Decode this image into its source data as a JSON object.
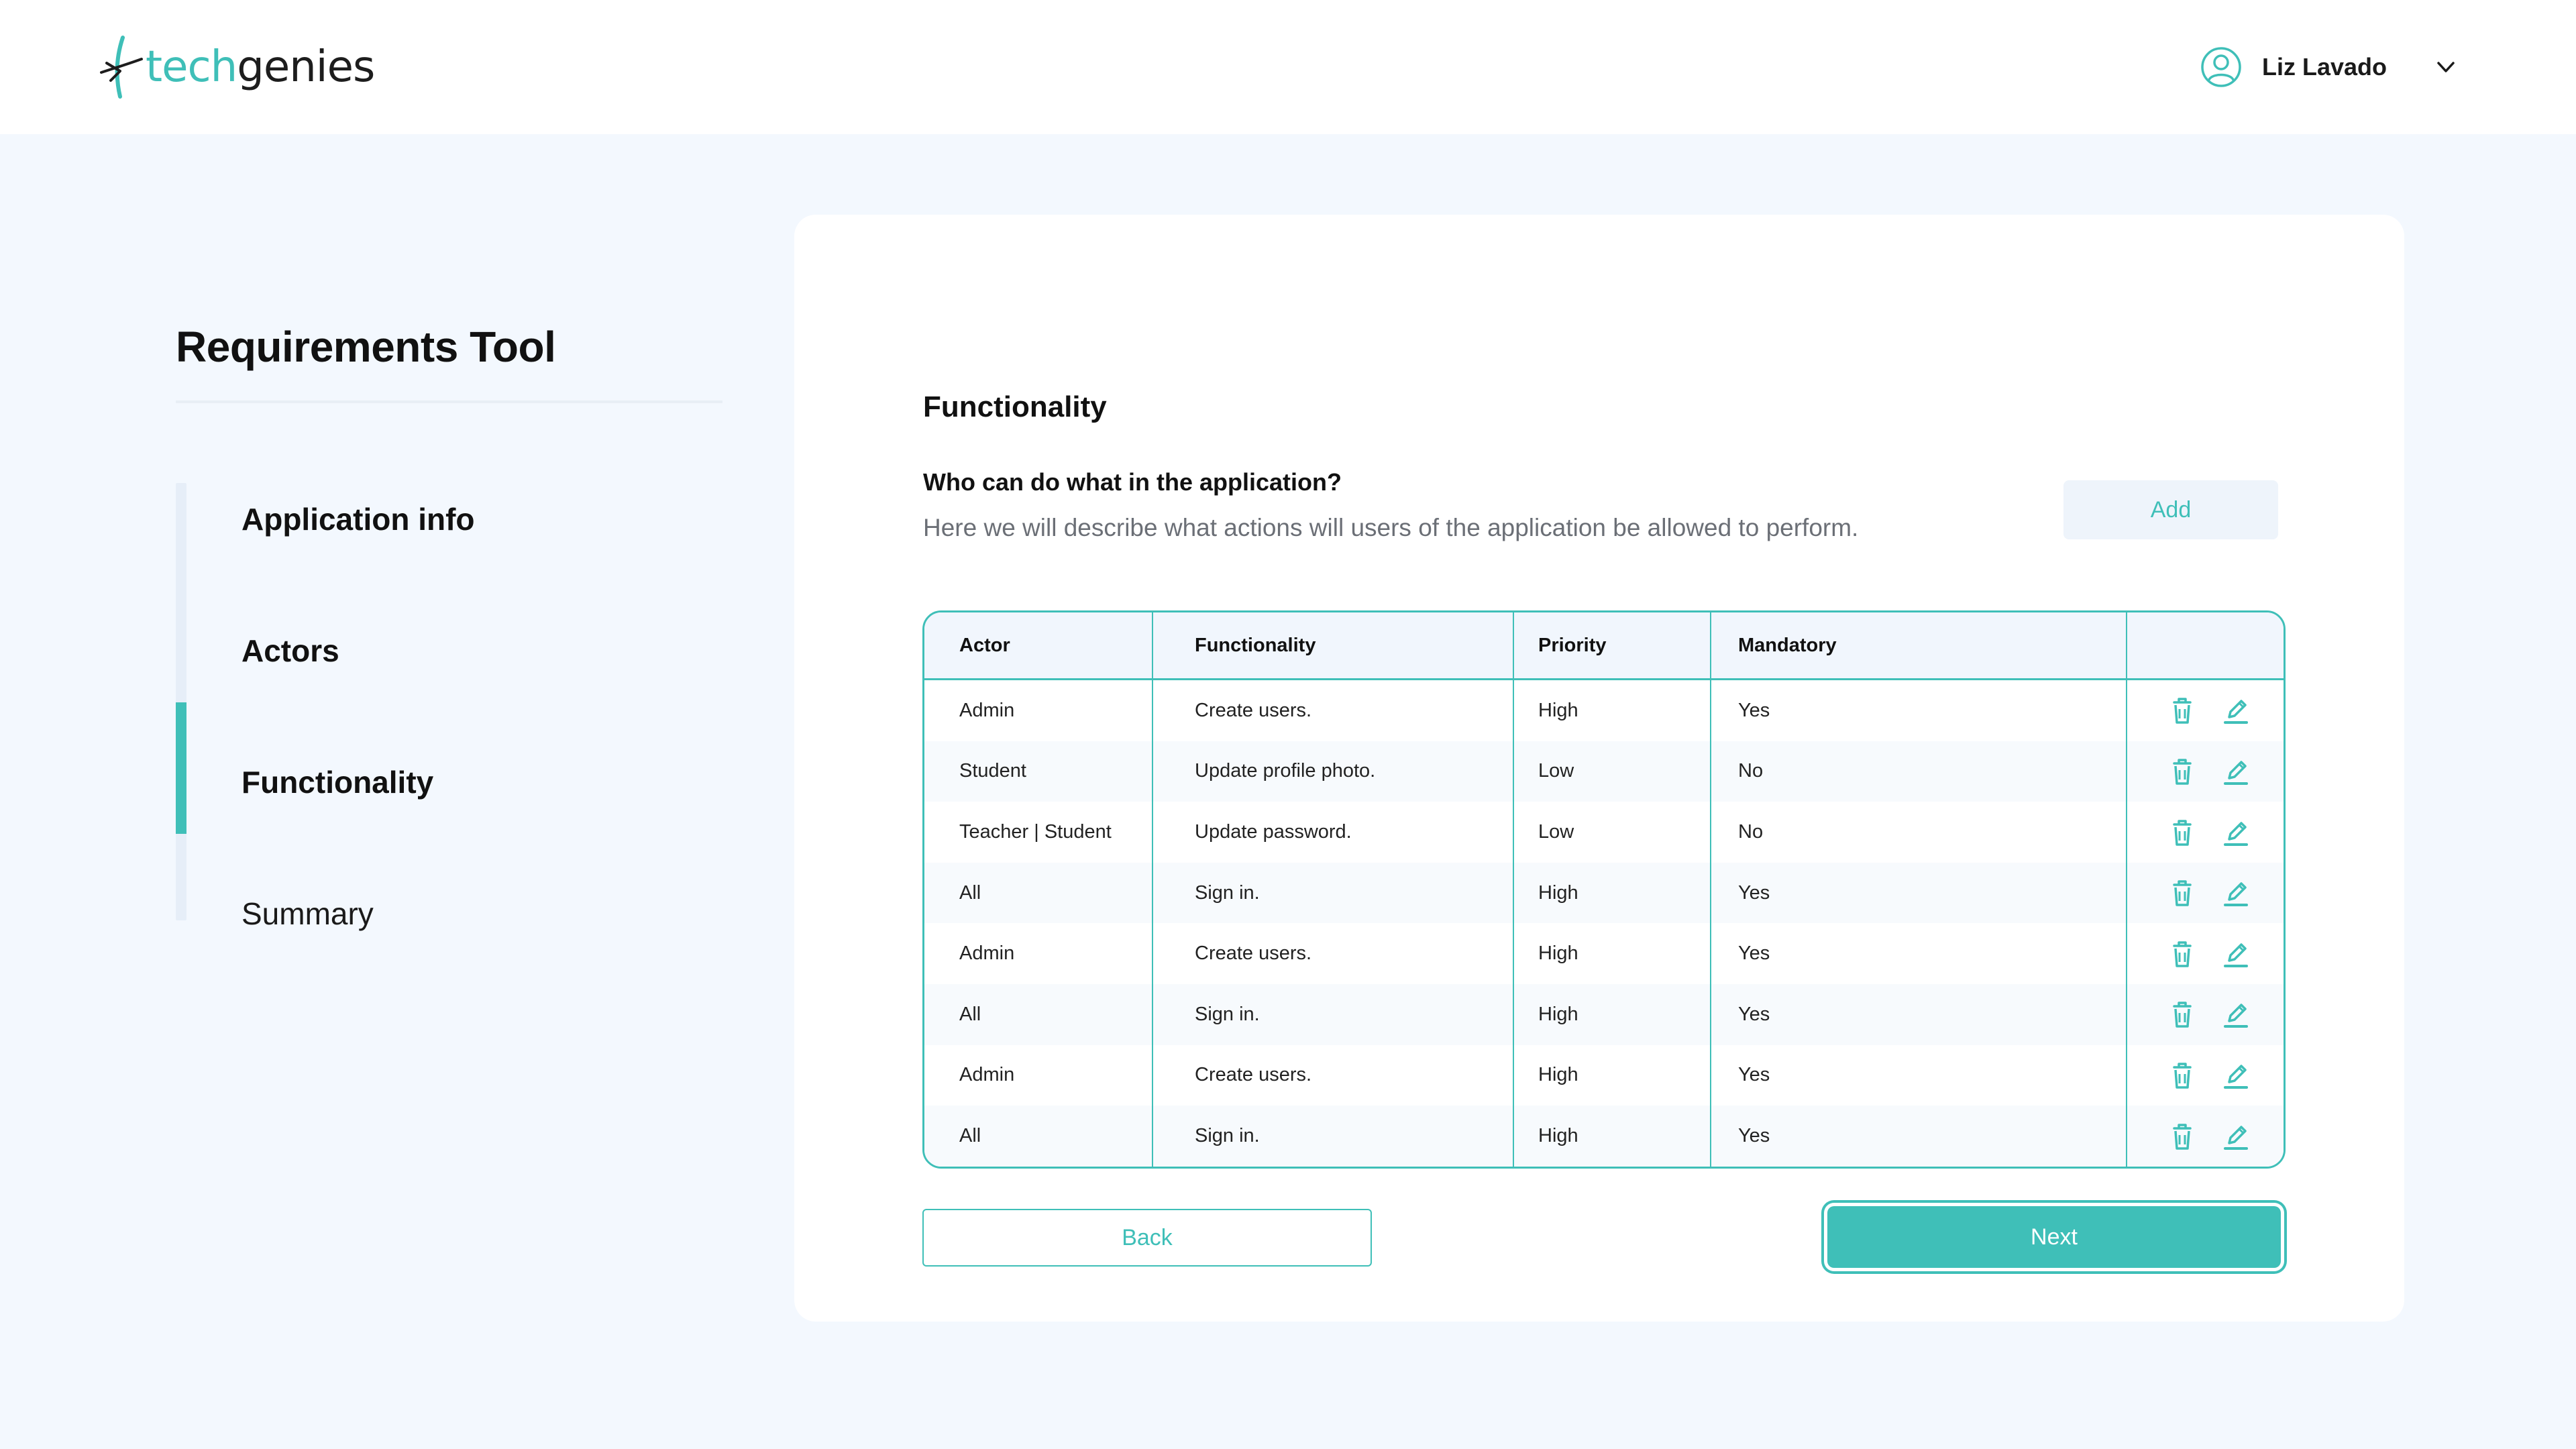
{
  "header": {
    "logo": {
      "part1": "tech",
      "part2": "genies",
      "icon": "techgenies-logo-icon"
    },
    "user": {
      "name": "Liz Lavado",
      "avatar_icon": "user-circle-icon",
      "menu_icon": "chevron-down-icon"
    }
  },
  "sidebar": {
    "title": "Requirements Tool",
    "steps": [
      {
        "label": "Application info",
        "active": false
      },
      {
        "label": "Actors",
        "active": false
      },
      {
        "label": "Functionality",
        "active": true
      },
      {
        "label": "Summary",
        "active": false
      }
    ]
  },
  "main": {
    "section_title": "Functionality",
    "question": "Who can do what in the application?",
    "description": "Here we will describe what actions will users of the application be allowed to perform.",
    "add_label": "Add",
    "table": {
      "headers": [
        "Actor",
        "Functionality",
        "Priority",
        "Mandatory",
        ""
      ],
      "rows": [
        {
          "actor": "Admin",
          "functionality": "Create users.",
          "priority": "High",
          "mandatory": "Yes"
        },
        {
          "actor": "Student",
          "functionality": "Update profile photo.",
          "priority": "Low",
          "mandatory": "No"
        },
        {
          "actor": "Teacher | Student",
          "functionality": "Update password.",
          "priority": "Low",
          "mandatory": "No"
        },
        {
          "actor": "All",
          "functionality": "Sign in.",
          "priority": "High",
          "mandatory": "Yes"
        },
        {
          "actor": "Admin",
          "functionality": "Create users.",
          "priority": "High",
          "mandatory": "Yes"
        },
        {
          "actor": "All",
          "functionality": "Sign in.",
          "priority": "High",
          "mandatory": "Yes"
        },
        {
          "actor": "Admin",
          "functionality": "Create users.",
          "priority": "High",
          "mandatory": "Yes"
        },
        {
          "actor": "All",
          "functionality": "Sign in.",
          "priority": "High",
          "mandatory": "Yes"
        }
      ],
      "row_actions": {
        "delete_icon": "trash-icon",
        "edit_icon": "pencil-icon"
      }
    },
    "back_label": "Back",
    "next_label": "Next"
  },
  "colors": {
    "accent": "#3fbfb8",
    "page_bg": "#f3f8fe",
    "card_bg": "#ffffff",
    "muted_text": "#6b6f76"
  }
}
